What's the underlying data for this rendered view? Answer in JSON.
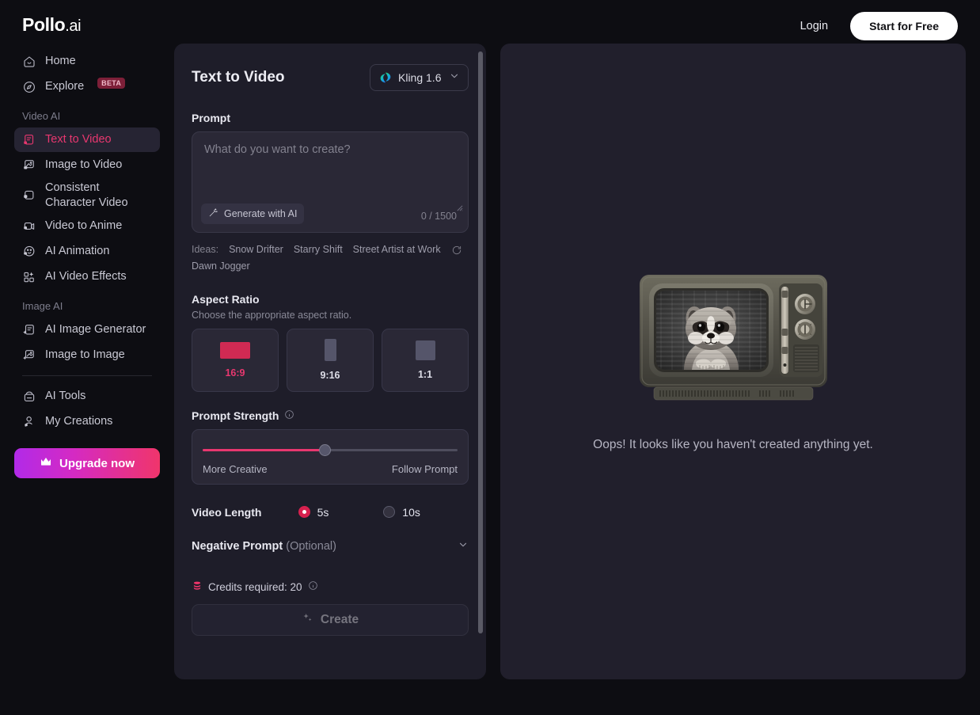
{
  "header": {
    "logo_main": "Pollo",
    "logo_suffix": ".ai",
    "login_label": "Login",
    "start_free_label": "Start for Free"
  },
  "sidebar": {
    "top_items": [
      {
        "label": "Home",
        "icon": "home-icon"
      },
      {
        "label": "Explore",
        "icon": "compass-icon",
        "badge": "BETA"
      }
    ],
    "video_group_title": "Video AI",
    "video_items": [
      {
        "label": "Text to Video",
        "icon": "text-to-video-icon",
        "active": true
      },
      {
        "label": "Image to Video",
        "icon": "image-to-video-icon"
      },
      {
        "label": "Consistent Character Video",
        "icon": "consistent-character-icon"
      },
      {
        "label": "Video to Anime",
        "icon": "video-to-anime-icon"
      },
      {
        "label": "AI Animation",
        "icon": "ai-animation-icon"
      },
      {
        "label": "AI Video Effects",
        "icon": "ai-video-effects-icon"
      }
    ],
    "image_group_title": "Image AI",
    "image_items": [
      {
        "label": "AI Image Generator",
        "icon": "ai-image-generator-icon"
      },
      {
        "label": "Image to Image",
        "icon": "image-to-image-icon"
      }
    ],
    "tool_items": [
      {
        "label": "AI Tools",
        "icon": "ai-tools-icon"
      },
      {
        "label": "My Creations",
        "icon": "my-creations-icon"
      }
    ],
    "upgrade_label": "Upgrade now"
  },
  "panel": {
    "title": "Text to Video",
    "model": "Kling 1.6",
    "prompt_label": "Prompt",
    "prompt_value": "",
    "prompt_placeholder": "What do you want to create?",
    "generate_with_ai_label": "Generate with AI",
    "char_count": "0 / 1500",
    "ideas_label": "Ideas:",
    "ideas": [
      "Snow Drifter",
      "Starry Shift",
      "Street Artist at Work",
      "Dawn Jogger"
    ],
    "aspect_ratio_label": "Aspect Ratio",
    "aspect_ratio_sub": "Choose the appropriate aspect ratio.",
    "aspect_ratios": [
      {
        "label": "16:9",
        "selected": true
      },
      {
        "label": "9:16",
        "selected": false
      },
      {
        "label": "1:1",
        "selected": false
      }
    ],
    "prompt_strength_label": "Prompt Strength",
    "prompt_strength_value": 48,
    "prompt_strength_min_label": "More Creative",
    "prompt_strength_max_label": "Follow Prompt",
    "video_length_label": "Video Length",
    "video_lengths": [
      {
        "label": "5s",
        "selected": true
      },
      {
        "label": "10s",
        "selected": false
      }
    ],
    "negative_prompt_label": "Negative Prompt",
    "negative_prompt_optional": " (Optional)",
    "credits_label": "Credits required: 20",
    "create_label": "Create"
  },
  "preview": {
    "empty_text": "Oops! It looks like you haven't created anything yet."
  },
  "colors": {
    "accent_pink": "#e8376f",
    "accent_crimson": "#d7204e",
    "panel_bg": "#1e1d29",
    "page_bg": "#0d0d12"
  }
}
